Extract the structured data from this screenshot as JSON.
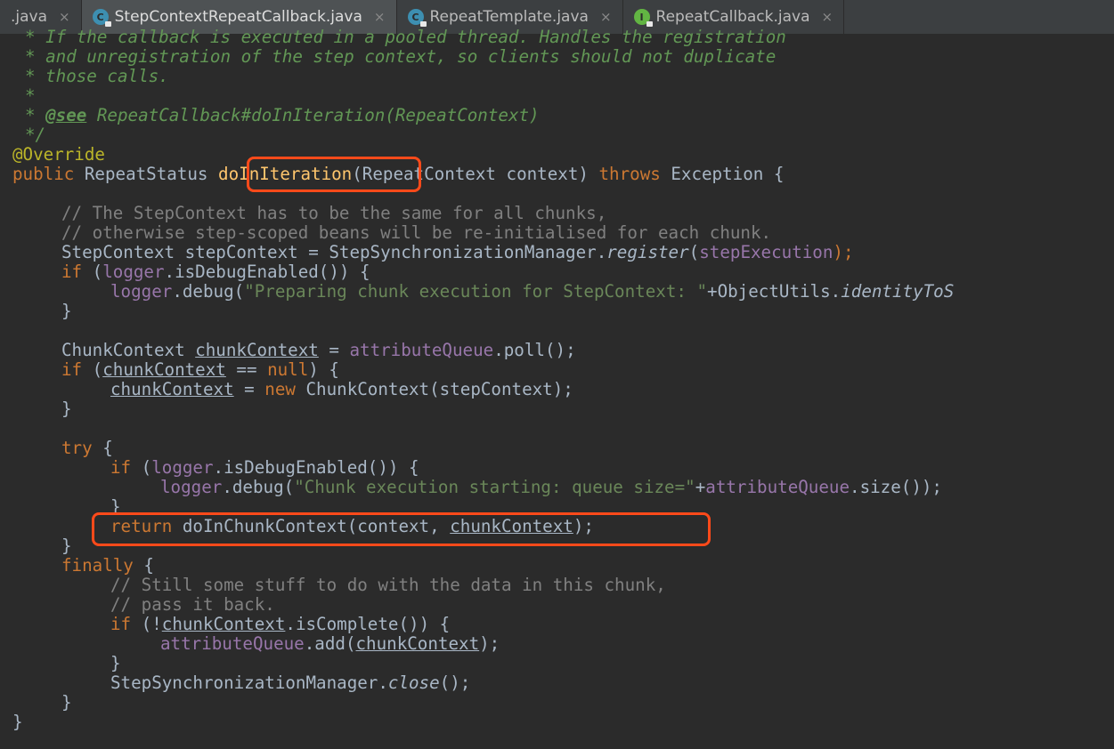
{
  "tabs": [
    {
      "label": ".java",
      "icon": "none",
      "active": false
    },
    {
      "label": "StepContextRepeatCallback.java",
      "icon": "class-icon",
      "active": true
    },
    {
      "label": "RepeatTemplate.java",
      "icon": "class-icon",
      "active": false
    },
    {
      "label": "RepeatCallback.java",
      "icon": "interface-icon",
      "active": false
    }
  ],
  "tab_close_glyph": "×",
  "icon_letters": {
    "class": "C",
    "interface": "I"
  },
  "colors": {
    "background": "#2b2b2b",
    "keyword": "#cc7832",
    "annotation": "#bbb529",
    "field": "#9876aa",
    "string": "#6a8759",
    "doc_comment": "#629755",
    "line_comment": "#808080",
    "highlight_box": "#ff4a1a"
  },
  "code": {
    "l01": "* If the callback is executed in a pooled thread. Handles the registration",
    "l02": "* and unregistration of the step context, so clients should not duplicate",
    "l03": "* those calls.",
    "l04": "*",
    "l05a": "* ",
    "l05tag": "@see",
    "l05b": " RepeatCallback#doInIteration(RepeatContext)",
    "l06": "*/",
    "l07": "@Override",
    "l08a": "public",
    "l08b": " RepeatStatus ",
    "l08fn": "doInIteration",
    "l08c": "(RepeatContext context) ",
    "l08d": "throws",
    "l08e": " Exception {",
    "l09": "// The StepContext has to be the same for all chunks,",
    "l10": "// otherwise step-scoped beans will be re-initialised for each chunk.",
    "l11a": "StepContext stepContext = StepSynchronizationManager.",
    "l11b": "register",
    "l11c": "(",
    "l11d": "stepExecution",
    "l11e": ");",
    "l12a": "if",
    "l12b": " (",
    "l12c": "logger",
    "l12d": ".isDebugEnabled()) {",
    "l13a": "logger",
    "l13b": ".debug(",
    "l13c": "\"Preparing chunk execution for StepContext: \"",
    "l13d": "+ObjectUtils.",
    "l13e": "identityToS",
    "l14": "}",
    "l15a": "ChunkContext ",
    "l15b": "chunkContext",
    "l15c": " = ",
    "l15d": "attributeQueue",
    "l15e": ".poll();",
    "l16a": "if",
    "l16b": " (",
    "l16c": "chunkContext",
    "l16d": " == ",
    "l16e": "null",
    "l16f": ") {",
    "l17a": "chunkContext",
    "l17b": " = ",
    "l17c": "new",
    "l17d": " ChunkContext(stepContext);",
    "l18": "}",
    "l19a": "try",
    "l19b": " {",
    "l20a": "if",
    "l20b": " (",
    "l20c": "logger",
    "l20d": ".isDebugEnabled()) {",
    "l21a": "logger",
    "l21b": ".debug(",
    "l21c": "\"Chunk execution starting: queue size=\"",
    "l21d": "+",
    "l21e": "attributeQueue",
    "l21f": ".size());",
    "l22": "}",
    "l23a": "return",
    "l23b": " doInChunkContext(context, ",
    "l23c": "chunkContext",
    "l23d": ");",
    "l24": "}",
    "l25a": "finally",
    "l25b": " {",
    "l26": "// Still some stuff to do with the data in this chunk,",
    "l27": "// pass it back.",
    "l28a": "if",
    "l28b": " (!",
    "l28c": "chunkContext",
    "l28d": ".isComplete()) {",
    "l29a": "attributeQueue",
    "l29b": ".add(",
    "l29c": "chunkContext",
    "l29d": ");",
    "l30": "}",
    "l31a": "StepSynchronizationManager.",
    "l31b": "close",
    "l31c": "();",
    "l32": "}",
    "l33": "}"
  }
}
